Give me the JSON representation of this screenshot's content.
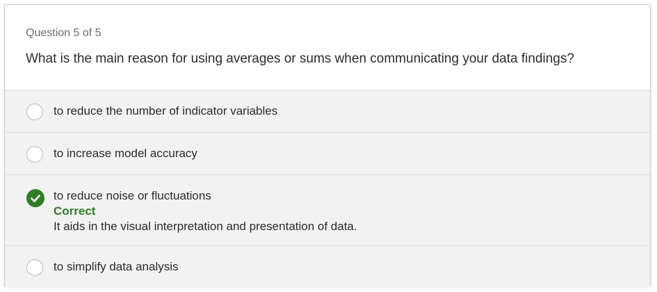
{
  "quiz": {
    "counter": "Question 5 of 5",
    "question": "What is the main reason for using averages or sums when communicating your data findings?",
    "options": [
      {
        "label": "to reduce the number of indicator variables",
        "state": "unselected"
      },
      {
        "label": "to increase model accuracy",
        "state": "unselected"
      },
      {
        "label": "to reduce noise or fluctuations",
        "state": "selected-correct",
        "result": "Correct",
        "explanation": "It aids in the visual interpretation and presentation of data."
      },
      {
        "label": "to simplify data analysis",
        "state": "unselected"
      }
    ]
  },
  "colors": {
    "correct": "#2f7d25",
    "option_background": "#f2f2f2",
    "text": "#2b2b2b"
  },
  "icons": {
    "selected": "checkmark-circle-icon",
    "unselected": "radio-circle-icon"
  }
}
